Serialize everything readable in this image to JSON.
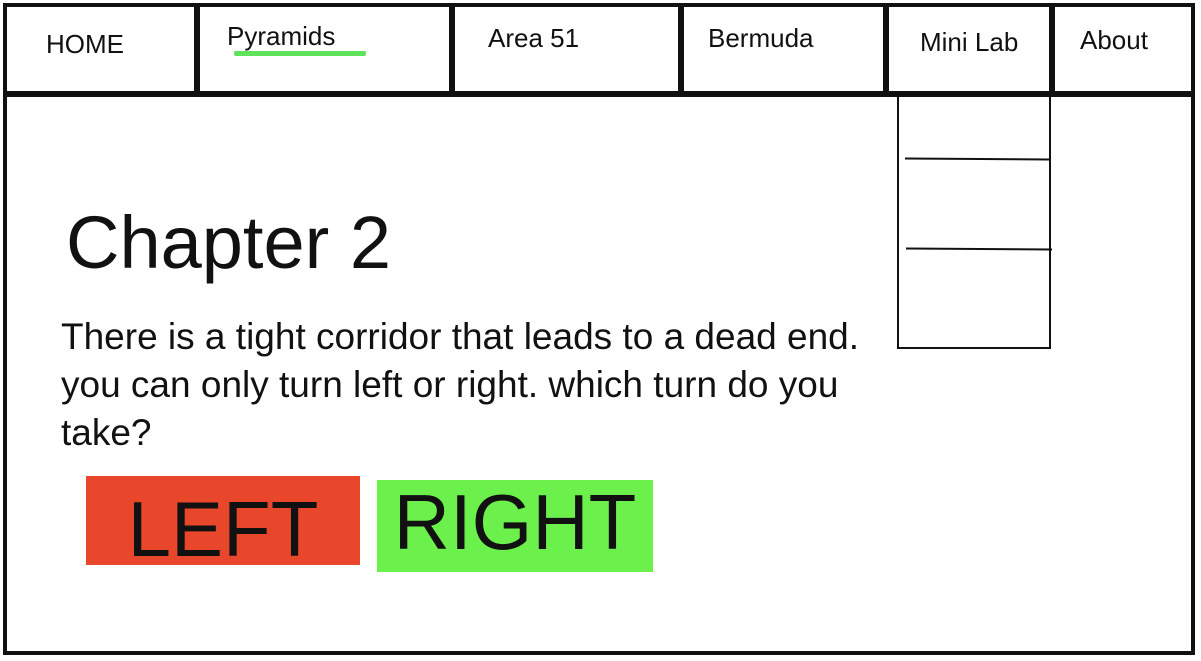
{
  "nav": {
    "items": [
      {
        "label": "HOME"
      },
      {
        "label": "Pyramids",
        "active": true
      },
      {
        "label": "Area 51"
      },
      {
        "label": "Bermuda"
      },
      {
        "label": "Mini Lab"
      },
      {
        "label": "About"
      }
    ],
    "active_underline_color": "#5ee35a"
  },
  "dropdown": {
    "parent": "Mini Lab",
    "items": [
      "",
      "",
      ""
    ]
  },
  "main": {
    "title": "Chapter 2",
    "story": "There is a tight corridor that leads to a dead end. you can only turn left or right. which turn do you take?",
    "choices": {
      "left": {
        "label": "LEFT",
        "color": "#e9472b"
      },
      "right": {
        "label": "RIGHT",
        "color": "#6cf04c"
      }
    }
  }
}
